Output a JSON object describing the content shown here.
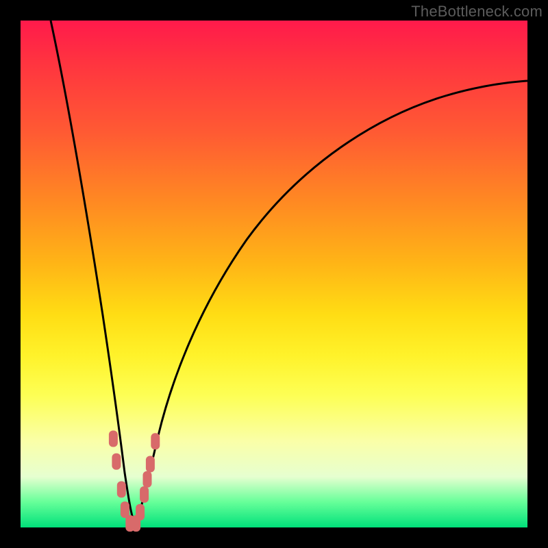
{
  "watermark": "TheBottleneck.com",
  "colors": {
    "frame": "#000000",
    "curve": "#000000",
    "marker": "#d86a6a",
    "gradient_top": "#ff1a4b",
    "gradient_bottom": "#00e07a"
  },
  "chart_data": {
    "type": "line",
    "title": "",
    "xlabel": "",
    "ylabel": "",
    "xlim": [
      0,
      100
    ],
    "ylim": [
      0,
      100
    ],
    "grid": false,
    "tick_labels_x": [],
    "tick_labels_y": [],
    "note": "Axes are unlabeled; x and y values are approximate percentages of the plot extent read from curve geometry.",
    "series": [
      {
        "name": "left-curve",
        "x": [
          6,
          8,
          10,
          12,
          14,
          15,
          16,
          17,
          18,
          18.6,
          19.2,
          19.8,
          20.5,
          21.0,
          21.6,
          22.2
        ],
        "y": [
          100,
          88,
          75,
          62,
          48,
          41,
          34,
          27,
          20,
          15,
          11,
          8,
          5,
          3,
          1,
          0
        ]
      },
      {
        "name": "right-curve",
        "x": [
          22.2,
          23.0,
          24.0,
          25.5,
          27.5,
          30,
          34,
          40,
          48,
          58,
          70,
          82,
          92,
          100
        ],
        "y": [
          0,
          3,
          7,
          12,
          19,
          27,
          37,
          48,
          58,
          67,
          75,
          81,
          85,
          88
        ]
      }
    ],
    "markers": {
      "name": "highlighted-region-points",
      "shape": "rounded-capsule",
      "color": "#d86a6a",
      "points": [
        {
          "x": 18.3,
          "y": 17.5
        },
        {
          "x": 18.9,
          "y": 13.0
        },
        {
          "x": 19.9,
          "y": 7.5
        },
        {
          "x": 20.6,
          "y": 3.5
        },
        {
          "x": 21.6,
          "y": 0.8
        },
        {
          "x": 22.8,
          "y": 0.8
        },
        {
          "x": 23.6,
          "y": 3.0
        },
        {
          "x": 24.4,
          "y": 6.5
        },
        {
          "x": 25.0,
          "y": 9.5
        },
        {
          "x": 25.6,
          "y": 12.5
        },
        {
          "x": 26.6,
          "y": 17.0
        }
      ]
    }
  }
}
